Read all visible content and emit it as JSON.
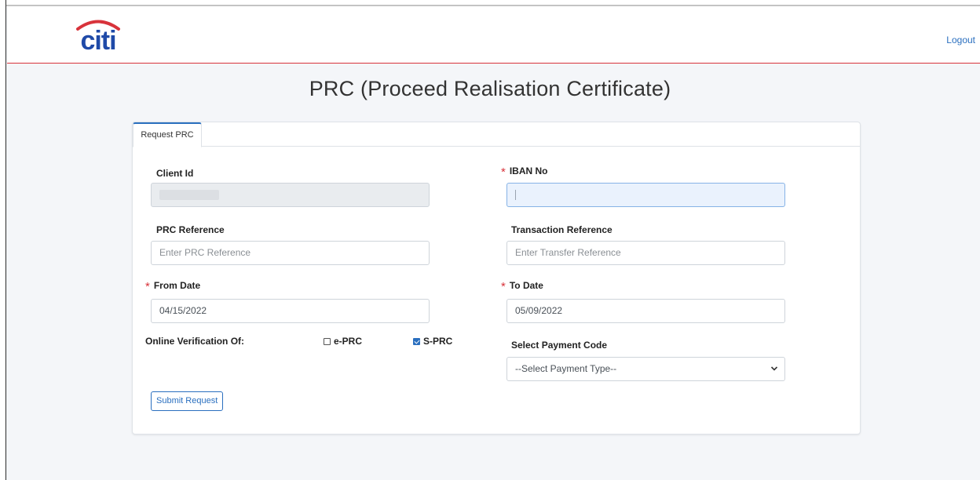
{
  "header": {
    "logo_text": "citi",
    "logout_label": "Logout",
    "brand_red": "#d8333b",
    "brand_blue": "#1f4aa8"
  },
  "page": {
    "title": "PRC (Proceed Realisation Certificate)"
  },
  "tabs": [
    {
      "label": "Request PRC",
      "active": true
    }
  ],
  "form": {
    "client_id": {
      "label": "Client Id",
      "value": ""
    },
    "iban_no": {
      "label": "IBAN No",
      "required": true,
      "value": ""
    },
    "prc_reference": {
      "label": "PRC Reference",
      "placeholder": "Enter PRC Reference"
    },
    "transaction_reference": {
      "label": "Transaction Reference",
      "placeholder": "Enter Transfer Reference"
    },
    "from_date": {
      "label": "From Date",
      "required": true,
      "value": "04/15/2022"
    },
    "to_date": {
      "label": "To Date",
      "required": true,
      "value": "05/09/2022"
    },
    "online_verification": {
      "label": "Online Verification Of:",
      "options": [
        {
          "label": "e-PRC",
          "checked": false
        },
        {
          "label": "S-PRC",
          "checked": true
        }
      ]
    },
    "payment_code": {
      "label": "Select Payment Code",
      "selected": "--Select Payment Type--"
    },
    "required_marker": "*",
    "submit_label": "Submit Request"
  }
}
